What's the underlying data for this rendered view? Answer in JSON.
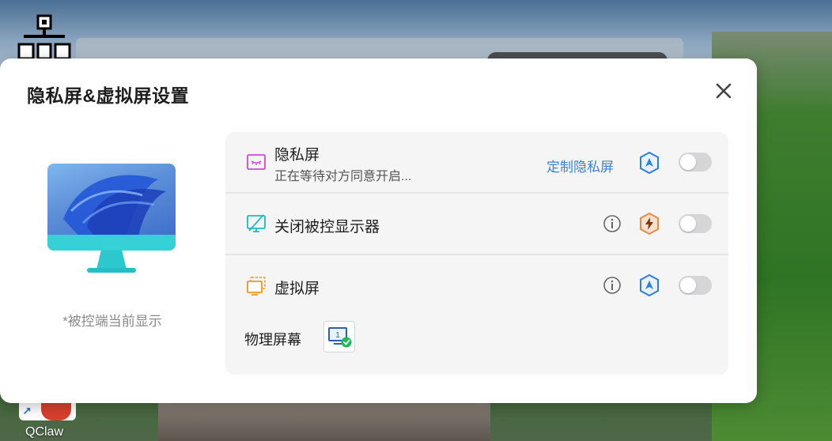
{
  "desktop": {
    "shortcut_label": "QClaw"
  },
  "dialog": {
    "title": "隐私屏&虚拟屏设置",
    "preview_caption": "*被控端当前显示"
  },
  "rows": {
    "privacy": {
      "title": "隐私屏",
      "subtitle": "正在等待对方同意开启...",
      "link": "定制隐私屏",
      "toggle_on": false
    },
    "monitor_off": {
      "title": "关闭被控显示器",
      "toggle_on": false
    },
    "virtual": {
      "title": "虚拟屏",
      "toggle_on": false,
      "physical_label": "物理屏幕",
      "physical_screen_number": "1"
    }
  },
  "colors": {
    "accent_blue": "#3b82d8",
    "privacy_icon": "#d04ad0",
    "monitor_icon": "#1fb8c6",
    "virtual_icon": "#f0961e",
    "badge_blue": "#2a7fe0",
    "badge_orange": "#e8884a",
    "check_green": "#20b85a"
  },
  "icons": {
    "close": "close-icon",
    "privacy": "privacy-screen-icon",
    "monitor_off": "monitor-off-icon",
    "virtual": "virtual-screen-icon",
    "info": "info-icon",
    "pro_badge": "navigation-badge-icon",
    "power_badge": "lightning-badge-icon"
  }
}
